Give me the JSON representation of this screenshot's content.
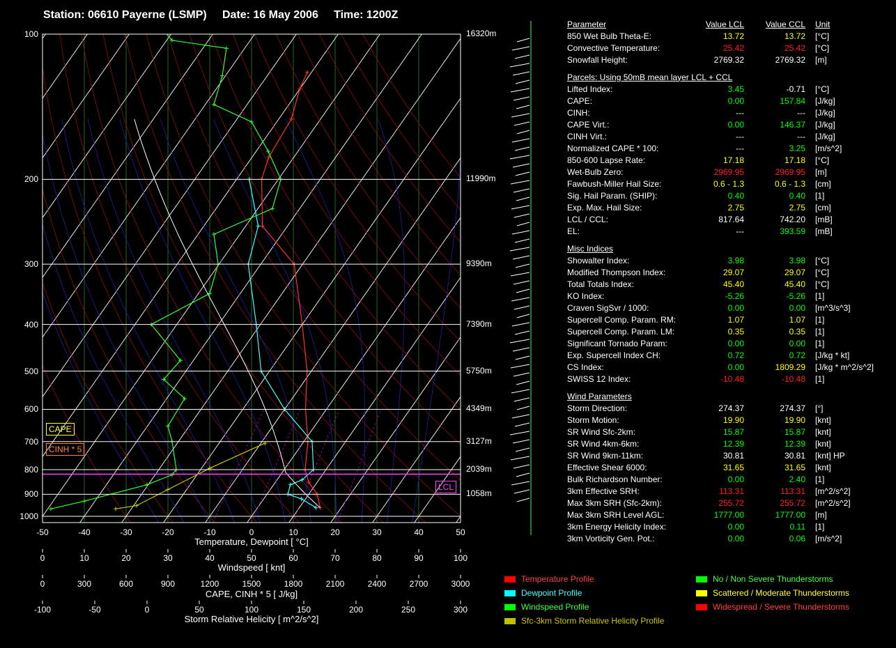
{
  "header": {
    "station": "Station: 06610 Payerne (LSMP)",
    "date": "Date: 16 May 2006",
    "time": "Time: 1200Z"
  },
  "chart_data": {
    "type": "line",
    "subtype": "skew-t log-p sounding",
    "xlabel": "Temperature, Dewpoint  [ °C]",
    "xlim": [
      -50,
      50
    ],
    "x_ticks": [
      "-50",
      "-40",
      "-30",
      "-20",
      "-10",
      "0",
      "10",
      "20",
      "30",
      "40",
      "50"
    ],
    "pressure_ticks": [
      "100",
      "200",
      "300",
      "400",
      "500",
      "600",
      "700",
      "800",
      "900",
      "1000"
    ],
    "height_labels": [
      {
        "p": 100,
        "label": "16320m"
      },
      {
        "p": 200,
        "label": "11990m"
      },
      {
        "p": 300,
        "label": "9390m"
      },
      {
        "p": 400,
        "label": "7390m"
      },
      {
        "p": 500,
        "label": "5750m"
      },
      {
        "p": 600,
        "label": "4349m"
      },
      {
        "p": 700,
        "label": "3127m"
      },
      {
        "p": 800,
        "label": "2039m"
      },
      {
        "p": 900,
        "label": "1058m"
      }
    ],
    "secondary_axes": [
      {
        "label": "Windspeed  [ knt]",
        "ticks": [
          "0",
          "10",
          "20",
          "30",
          "40",
          "50",
          "60",
          "70",
          "80",
          "90",
          "100"
        ]
      },
      {
        "label": "CAPE, CINH * 5  [ J/kg]",
        "ticks": [
          "0",
          "300",
          "600",
          "900",
          "1200",
          "1500",
          "1800",
          "2100",
          "2400",
          "2700",
          "3000"
        ]
      },
      {
        "label": "Storm Relative Helicity  [ m^2/s^2]",
        "ticks": [
          "-100",
          "-50",
          "0",
          "50",
          "100",
          "150",
          "200",
          "250",
          "300"
        ]
      }
    ],
    "series": [
      {
        "name": "Temperature Profile",
        "color": "#ff3030",
        "points": [
          [
            15,
            960
          ],
          [
            12,
            900
          ],
          [
            8,
            850
          ],
          [
            5,
            800
          ],
          [
            1,
            700
          ],
          [
            -5,
            600
          ],
          [
            -11,
            500
          ],
          [
            -20,
            400
          ],
          [
            -32,
            300
          ],
          [
            -46,
            250
          ],
          [
            -54,
            200
          ],
          [
            -56,
            180
          ],
          [
            -57,
            150
          ],
          [
            -60,
            130
          ],
          [
            -61,
            120
          ]
        ]
      },
      {
        "name": "Dewpoint Profile",
        "color": "#40ffff",
        "points": [
          [
            14,
            960
          ],
          [
            9,
            920
          ],
          [
            5,
            900
          ],
          [
            4,
            860
          ],
          [
            6,
            840
          ],
          [
            7,
            800
          ],
          [
            2,
            700
          ],
          [
            -10,
            600
          ],
          [
            -22,
            500
          ],
          [
            -31,
            400
          ],
          [
            -43,
            300
          ],
          [
            -47,
            250
          ],
          [
            -57,
            200
          ]
        ]
      },
      {
        "name": "Windspeed Profile",
        "color": "#30ff30",
        "points": [
          [
            2,
            965
          ],
          [
            10,
            930
          ],
          [
            25,
            860
          ],
          [
            31,
            820
          ],
          [
            32,
            800
          ],
          [
            31,
            700
          ],
          [
            30,
            650
          ],
          [
            34,
            570
          ],
          [
            29,
            520
          ],
          [
            33,
            475
          ],
          [
            26,
            400
          ],
          [
            40,
            345
          ],
          [
            42,
            300
          ],
          [
            41,
            260
          ],
          [
            55,
            230
          ],
          [
            57,
            200
          ],
          [
            54,
            175
          ],
          [
            50,
            152
          ],
          [
            41,
            140
          ],
          [
            43,
            122
          ],
          [
            44,
            107
          ],
          [
            31,
            103
          ],
          [
            28,
            96
          ],
          [
            29,
            90
          ],
          [
            28,
            84
          ],
          [
            33,
            80
          ],
          [
            34,
            75
          ],
          [
            37,
            71
          ],
          [
            29,
            63
          ],
          [
            29,
            59
          ]
        ]
      },
      {
        "name": "Sfc-3km Storm Relative Helicity Profile",
        "color": "#c8c800",
        "points": [
          [
            -30,
            965
          ],
          [
            -10,
            950
          ],
          [
            20,
            880
          ],
          [
            60,
            795
          ],
          [
            113,
            705
          ]
        ]
      }
    ],
    "annotations": [
      "CAPE",
      "CINH * 5",
      "LCL"
    ],
    "lcl_pressure": 817.64
  },
  "labels": {
    "cape": "CAPE",
    "cinh": "CINH * 5",
    "lcl": "LCL"
  },
  "table": {
    "header": [
      "Parameter",
      "Value LCL",
      "Value CCL",
      "Unit"
    ],
    "rows": [
      {
        "name": "850 Wet Bulb Theta-E:",
        "lcl": "13.72",
        "ccl": "13.72",
        "unit": "[°C]",
        "cl": "y",
        "cc": "y"
      },
      {
        "name": "Convective Temperature:",
        "lcl": "25.42",
        "ccl": "25.42",
        "unit": "[°C]",
        "cl": "r",
        "cc": "r"
      },
      {
        "name": "Snowfall Height:",
        "lcl": "2769.32",
        "ccl": "2769.32",
        "unit": "[m]",
        "cl": "w",
        "cc": "w"
      },
      {
        "section": "Parcels: Using 50mB mean layer LCL + CCL"
      },
      {
        "name": "Lifted Index:",
        "lcl": "3.45",
        "ccl": "-0.71",
        "unit": "[°C]",
        "cl": "g",
        "cc": "w"
      },
      {
        "name": "CAPE:",
        "lcl": "0.00",
        "ccl": "157.84",
        "unit": "[J/kg]",
        "cl": "g",
        "cc": "g"
      },
      {
        "name": "CINH:",
        "lcl": "---",
        "ccl": "---",
        "unit": "[J/kg]",
        "cl": "w",
        "cc": "w"
      },
      {
        "name": "CAPE Virt.:",
        "lcl": "0.00",
        "ccl": "146.37",
        "unit": "[J/kg]",
        "cl": "g",
        "cc": "g"
      },
      {
        "name": "CINH Virt.:",
        "lcl": "---",
        "ccl": "---",
        "unit": "[J/kg]",
        "cl": "w",
        "cc": "w"
      },
      {
        "name": "Normalized CAPE * 100:",
        "lcl": "---",
        "ccl": "3.25",
        "unit": "[m/s^2]",
        "cl": "w",
        "cc": "g"
      },
      {
        "name": "850-600 Lapse Rate:",
        "lcl": "17.18",
        "ccl": "17.18",
        "unit": "[°C]",
        "cl": "y",
        "cc": "y"
      },
      {
        "name": "Wet-Bulb Zero:",
        "lcl": "2969.95",
        "ccl": "2969.95",
        "unit": "[m]",
        "cl": "r",
        "cc": "r"
      },
      {
        "name": "Fawbush-Miller Hail Size:",
        "lcl": "0.6 - 1.3",
        "ccl": "0.6 - 1.3",
        "unit": "[cm]",
        "cl": "y",
        "cc": "y"
      },
      {
        "name": "Sig. Hail Param. (SHIP):",
        "lcl": "0.40",
        "ccl": "0.40",
        "unit": "[1]",
        "cl": "g",
        "cc": "g"
      },
      {
        "name": "Exp. Max. Hail Size:",
        "lcl": "2.75",
        "ccl": "2.75",
        "unit": "[cm]",
        "cl": "y",
        "cc": "y"
      },
      {
        "name": "LCL / CCL:",
        "lcl": "817.64",
        "ccl": "742.20",
        "unit": "[mB]",
        "cl": "w",
        "cc": "w"
      },
      {
        "name": "EL:",
        "lcl": "---",
        "ccl": "393.59",
        "unit": "[mB]",
        "cl": "w",
        "cc": "g"
      },
      {
        "section": "Misc Indices"
      },
      {
        "name": "Showalter Index:",
        "lcl": "3.98",
        "ccl": "3.98",
        "unit": "[°C]",
        "cl": "g",
        "cc": "g"
      },
      {
        "name": "Modified Thompson Index:",
        "lcl": "29.07",
        "ccl": "29.07",
        "unit": "[°C]",
        "cl": "y",
        "cc": "y"
      },
      {
        "name": "Total Totals Index:",
        "lcl": "45.40",
        "ccl": "45.40",
        "unit": "[°C]",
        "cl": "y",
        "cc": "y"
      },
      {
        "name": "KO Index:",
        "lcl": "-5.26",
        "ccl": "-5.26",
        "unit": "[1]",
        "cl": "g",
        "cc": "g"
      },
      {
        "name": "Craven SigSvr / 1000:",
        "lcl": "0.00",
        "ccl": "0.00",
        "unit": "[m^3/s^3]",
        "cl": "g",
        "cc": "g"
      },
      {
        "name": "Supercell Comp. Param. RM:",
        "lcl": "1.07",
        "ccl": "1.07",
        "unit": "[1]",
        "cl": "y",
        "cc": "y"
      },
      {
        "name": "Supercell Comp. Param. LM:",
        "lcl": "0.35",
        "ccl": "0.35",
        "unit": "[1]",
        "cl": "y",
        "cc": "y"
      },
      {
        "name": "Significant Tornado Param:",
        "lcl": "0.00",
        "ccl": "0.00",
        "unit": "[1]",
        "cl": "g",
        "cc": "g"
      },
      {
        "name": "Exp. Supercell Index CH:",
        "lcl": "0.72",
        "ccl": "0.72",
        "unit": "[J/kg * kt]",
        "cl": "g",
        "cc": "g"
      },
      {
        "name": "CS Index:",
        "lcl": "0.00",
        "ccl": "1809.29",
        "unit": "[J/kg * m^2/s^2]",
        "cl": "g",
        "cc": "y"
      },
      {
        "name": "SWISS 12 Index:",
        "lcl": "-10.48",
        "ccl": "-10.48",
        "unit": "[1]",
        "cl": "r",
        "cc": "r"
      },
      {
        "section": "Wind Parameters"
      },
      {
        "name": "Storm Direction:",
        "lcl": "274.37",
        "ccl": "274.37",
        "unit": "[°]",
        "cl": "w",
        "cc": "w"
      },
      {
        "name": "Storm Motion:",
        "lcl": "19.90",
        "ccl": "19.90",
        "unit": "[knt]",
        "cl": "y",
        "cc": "y"
      },
      {
        "name": "SR Wind Sfc-2km:",
        "lcl": "15.87",
        "ccl": "15.87",
        "unit": "[knt]",
        "cl": "g",
        "cc": "g"
      },
      {
        "name": "SR Wind 4km-6km:",
        "lcl": "12.39",
        "ccl": "12.39",
        "unit": "[knt]",
        "cl": "g",
        "cc": "g"
      },
      {
        "name": "SR Wind 9km-11km:",
        "lcl": "30.81",
        "ccl": "30.81",
        "unit": "[knt] HP",
        "cl": "w",
        "cc": "w"
      },
      {
        "name": "Effective Shear 6000:",
        "lcl": "31.65",
        "ccl": "31.65",
        "unit": "[knt]",
        "cl": "y",
        "cc": "y"
      },
      {
        "name": "Bulk Richardson Number:",
        "lcl": "0.00",
        "ccl": "2.40",
        "unit": "[1]",
        "cl": "g",
        "cc": "g"
      },
      {
        "name": "3km Effective SRH:",
        "lcl": "113.31",
        "ccl": "113.31",
        "unit": "[m^2/s^2]",
        "cl": "r",
        "cc": "r"
      },
      {
        "name": "Max 3km SRH (Sfc-2km):",
        "lcl": "255.72",
        "ccl": "255.72",
        "unit": "[m^2/s^2]",
        "cl": "r",
        "cc": "r"
      },
      {
        "name": "Max 3km SRH Level AGL:",
        "lcl": "1777.00",
        "ccl": "1777.00",
        "unit": "[m]",
        "cl": "g",
        "cc": "g"
      },
      {
        "name": "3km Energy Helicity Index:",
        "lcl": "0.00",
        "ccl": "0.11",
        "unit": "[1]",
        "cl": "g",
        "cc": "g"
      },
      {
        "name": "3km Vorticity Gen. Pot.:",
        "lcl": "0.00",
        "ccl": "0.06",
        "unit": "[m/s^2]",
        "cl": "g",
        "cc": "g"
      }
    ]
  },
  "legend": {
    "profiles": [
      {
        "label": "Temperature Profile",
        "color": "#ff0000",
        "text_color": "#ff4040"
      },
      {
        "label": "Dewpoint Profile",
        "color": "#00ffff",
        "text_color": "#40ffff"
      },
      {
        "label": "Windspeed Profile",
        "color": "#00ff00",
        "text_color": "#40ff40"
      },
      {
        "label": "Sfc-3km Storm Relative Helicity Profile",
        "color": "#c0c000",
        "text_color": "#c8c800"
      }
    ],
    "categories": [
      {
        "label": "No / Non Severe Thunderstorms",
        "color": "#00ff00",
        "text_color": "#40ff40"
      },
      {
        "label": "Scattered / Moderate Thunderstorms",
        "color": "#ffff00",
        "text_color": "#ffff40"
      },
      {
        "label": "Widespread / Severe Thunderstorms",
        "color": "#ff0000",
        "text_color": "#ff4040"
      }
    ]
  }
}
